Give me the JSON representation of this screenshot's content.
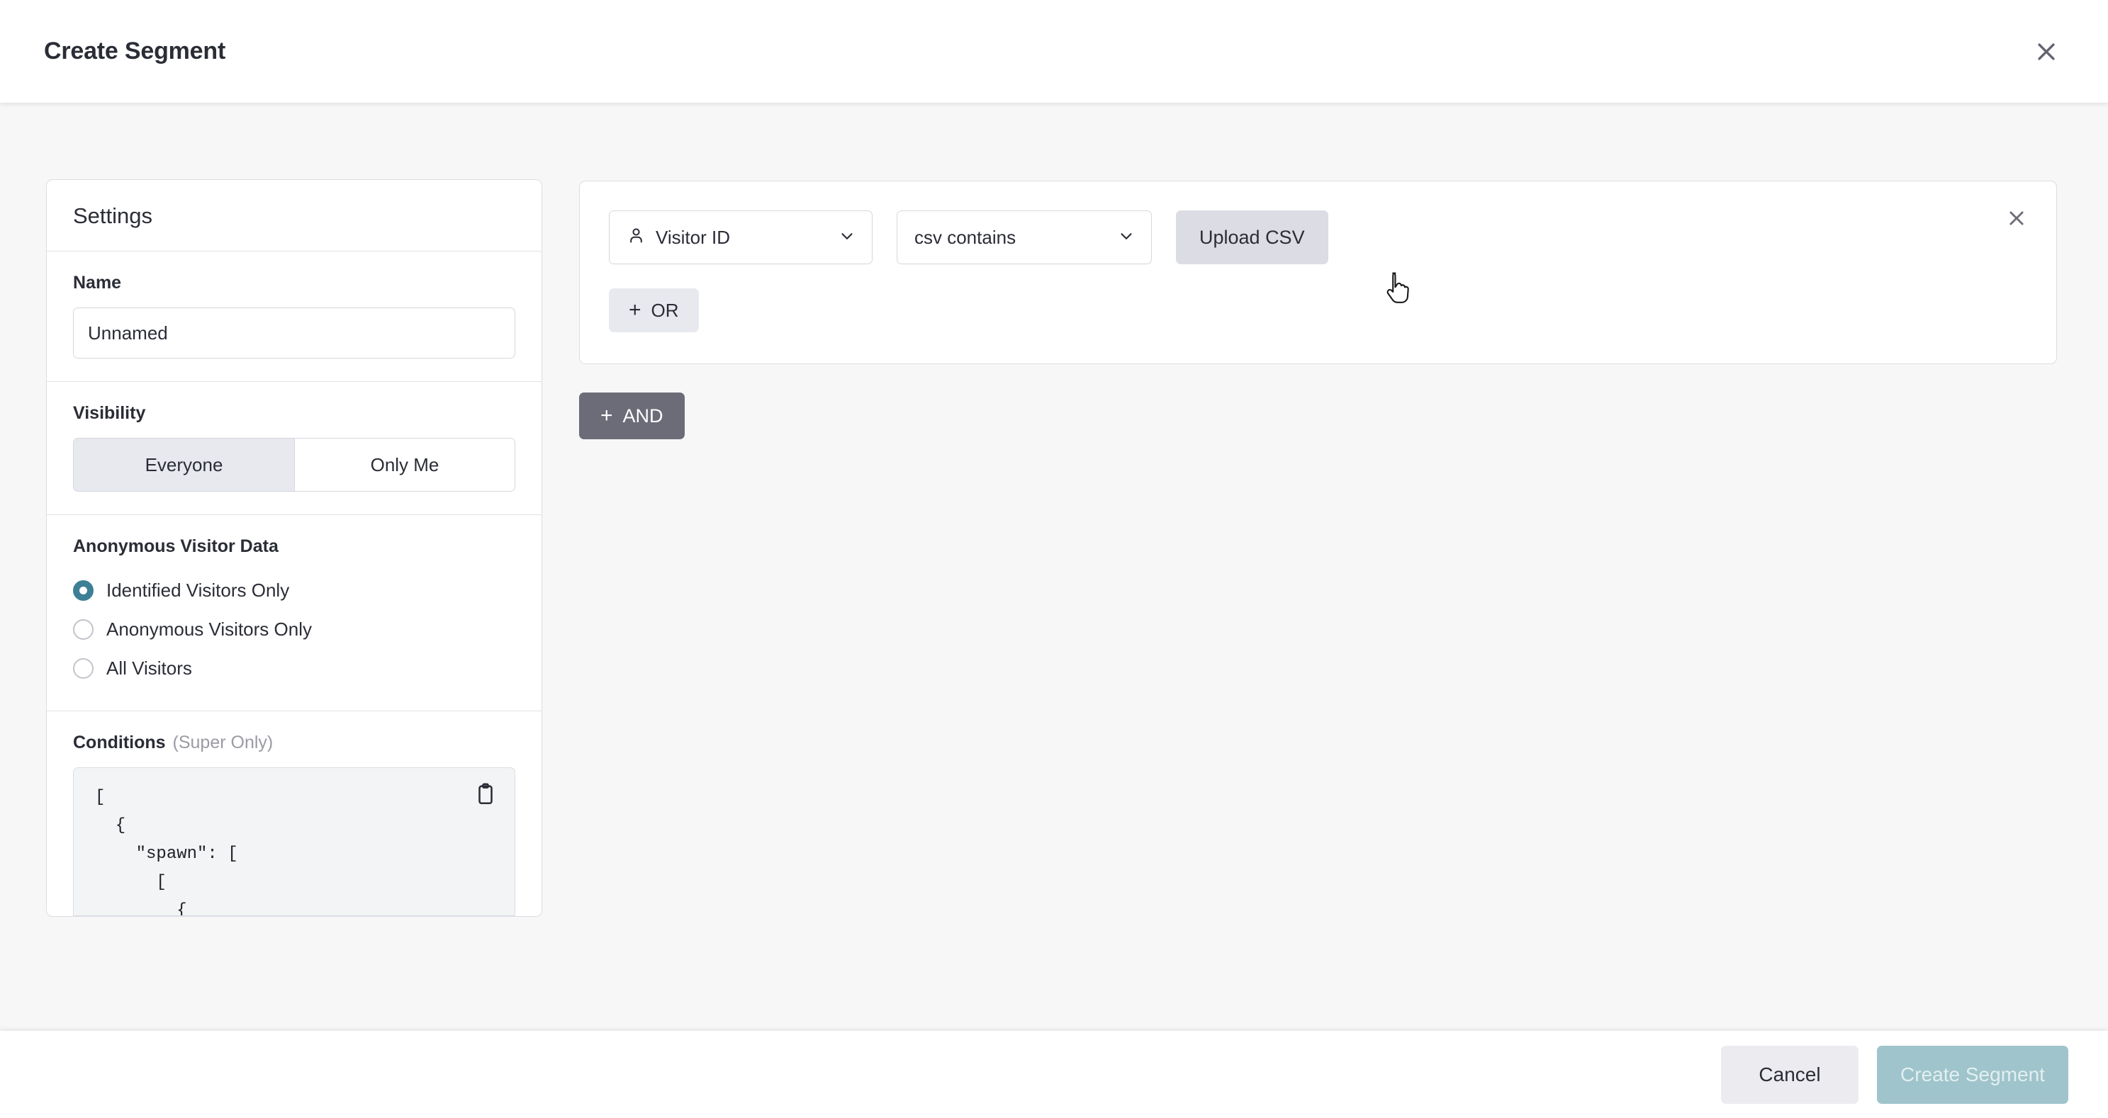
{
  "header": {
    "title": "Create Segment",
    "close_icon": "close-icon"
  },
  "settings": {
    "panel_title": "Settings",
    "name": {
      "label": "Name",
      "value": "Unnamed",
      "placeholder": "Unnamed"
    },
    "visibility": {
      "label": "Visibility",
      "options": [
        {
          "label": "Everyone",
          "selected": true
        },
        {
          "label": "Only Me",
          "selected": false
        }
      ]
    },
    "anonymous_visitor_data": {
      "label": "Anonymous Visitor Data",
      "options": [
        {
          "label": "Identified Visitors Only",
          "selected": true
        },
        {
          "label": "Anonymous Visitors Only",
          "selected": false
        },
        {
          "label": "All Visitors",
          "selected": false
        }
      ]
    },
    "conditions": {
      "label": "Conditions",
      "sublabel": "(Super Only)",
      "copy_icon": "clipboard-icon",
      "code": "[\n  {\n    \"spawn\": [\n      [\n        {"
    }
  },
  "rules": {
    "condition_card": {
      "remove_icon": "close-icon",
      "attribute_select": {
        "icon": "person-icon",
        "value": "Visitor ID",
        "chevron": "chevron-down-icon"
      },
      "operator_select": {
        "value": "csv contains",
        "chevron": "chevron-down-icon"
      },
      "upload_button": "Upload CSV",
      "or_button": "OR",
      "plus_glyph": "+"
    },
    "and_button": "AND"
  },
  "footer": {
    "cancel_label": "Cancel",
    "create_label": "Create Segment"
  },
  "colors": {
    "accent_teal": "#3d7f95",
    "primary_disabled": "#9fc4cb",
    "and_button_bg": "#6b6c77",
    "upload_button_bg": "#dcdce5",
    "page_bg": "#f7f7f8"
  },
  "cursor": {
    "type": "pointer-hand-cursor"
  }
}
